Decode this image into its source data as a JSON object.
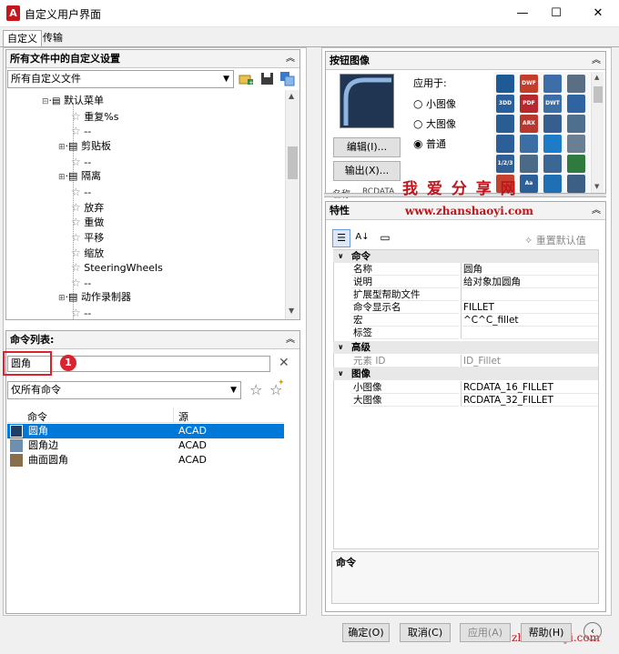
{
  "window": {
    "title": "自定义用户界面"
  },
  "tabs": [
    "自定义",
    "传输"
  ],
  "customizations": {
    "header": "所有文件中的自定义设置",
    "filter": "所有自定义文件",
    "tree": [
      {
        "label": "默认菜单",
        "type": "menu"
      },
      {
        "label": "重复%s",
        "type": "item"
      },
      {
        "label": "--",
        "type": "item"
      },
      {
        "label": "剪贴板",
        "type": "folder"
      },
      {
        "label": "--",
        "type": "item"
      },
      {
        "label": "隔离",
        "type": "folder"
      },
      {
        "label": "--",
        "type": "item"
      },
      {
        "label": "放弃",
        "type": "item"
      },
      {
        "label": "重做",
        "type": "item"
      },
      {
        "label": "平移",
        "type": "item"
      },
      {
        "label": "缩放",
        "type": "item"
      },
      {
        "label": "SteeringWheels",
        "type": "item"
      },
      {
        "label": "--",
        "type": "item"
      },
      {
        "label": "动作录制器",
        "type": "folder"
      },
      {
        "label": "--",
        "type": "item"
      }
    ]
  },
  "command_list": {
    "header": "命令列表:",
    "search_value": "圆角",
    "callout": "1",
    "filter": "仅所有命令",
    "columns": [
      "命令",
      "源"
    ],
    "rows": [
      {
        "command": "圆角",
        "source": "ACAD",
        "selected": true
      },
      {
        "command": "圆角边",
        "source": "ACAD",
        "selected": false
      },
      {
        "command": "曲面圆角",
        "source": "ACAD",
        "selected": false
      }
    ]
  },
  "button_image": {
    "header": "按钮图像",
    "apply_to": "应用于:",
    "options": [
      "小图像",
      "大图像",
      "普通"
    ],
    "selected_option": "普通",
    "edit_button": "编辑(I)...",
    "export_button": "输出(X)...",
    "name_partial": "名称",
    "value_partial": "RCDATA",
    "icons": [
      {
        "label": "",
        "color": "#1e5a96"
      },
      {
        "label": "DWF",
        "color": "#c43c2a"
      },
      {
        "label": "",
        "color": "#3d6ea8"
      },
      {
        "label": "",
        "color": "#5a6f84"
      },
      {
        "label": "3DD",
        "color": "#2a5f9e"
      },
      {
        "label": "PDF",
        "color": "#b7282e"
      },
      {
        "label": "DWT",
        "color": "#3a6ea5"
      },
      {
        "label": "",
        "color": "#2f63a1"
      },
      {
        "label": "",
        "color": "#2b5d95"
      },
      {
        "label": "ARX",
        "color": "#b8372e"
      },
      {
        "label": "",
        "color": "#365f8f"
      },
      {
        "label": "",
        "color": "#4f6f8f"
      },
      {
        "label": "",
        "color": "#2c5f97"
      },
      {
        "label": "",
        "color": "#3a6ea5"
      },
      {
        "label": "",
        "color": "#1d7cc7"
      },
      {
        "label": "",
        "color": "#6a7f94"
      },
      {
        "label": "1/2/3",
        "color": "#2f5f95"
      },
      {
        "label": "",
        "color": "#4b6a88"
      },
      {
        "label": "",
        "color": "#3b6795"
      },
      {
        "label": "",
        "color": "#2f7a3e"
      },
      {
        "label": "",
        "color": "#c4402f"
      },
      {
        "label": "Aa",
        "color": "#2d5f98"
      },
      {
        "label": "",
        "color": "#1f6fb5"
      },
      {
        "label": "",
        "color": "#3c5f85"
      }
    ]
  },
  "properties": {
    "header": "特性",
    "reset_button": "重置默认值",
    "categories": [
      {
        "name": "命令",
        "rows": [
          {
            "key": "名称",
            "value": "圆角",
            "disabled": false
          },
          {
            "key": "说明",
            "value": "给对象加圆角",
            "disabled": false
          },
          {
            "key": "扩展型帮助文件",
            "value": "",
            "disabled": false
          },
          {
            "key": "命令显示名",
            "value": "FILLET",
            "disabled": false
          },
          {
            "key": "宏",
            "value": "^C^C_fillet",
            "disabled": false
          },
          {
            "key": "标签",
            "value": "",
            "disabled": false
          }
        ]
      },
      {
        "name": "高级",
        "rows": [
          {
            "key": "元素 ID",
            "value": "ID_Fillet",
            "disabled": true
          }
        ]
      },
      {
        "name": "图像",
        "rows": [
          {
            "key": "小图像",
            "value": "RCDATA_16_FILLET",
            "disabled": false
          },
          {
            "key": "大图像",
            "value": "RCDATA_32_FILLET",
            "disabled": false
          }
        ]
      }
    ],
    "description_title": "命令"
  },
  "watermark": {
    "line1": "我 爱 分 享 网",
    "line2": "www.zhanshaoyi.com",
    "bottom": "zhanshaoyi.com"
  },
  "footer": {
    "ok": "确定(O)",
    "cancel": "取消(C)",
    "apply": "应用(A)",
    "help": "帮助(H)"
  },
  "colors": {
    "selection": "#0078d7",
    "callout": "#d9232e",
    "watermark": "#c0161c"
  }
}
